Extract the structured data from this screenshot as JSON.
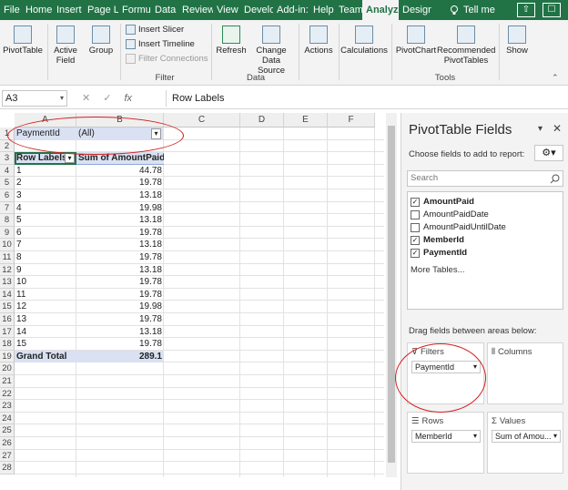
{
  "tabs": [
    "File",
    "Home",
    "Insert",
    "Page La",
    "Formul",
    "Data",
    "Review",
    "View",
    "Develo",
    "Add-in:",
    "Help",
    "Team",
    "Analyze",
    "Design"
  ],
  "tell_me": "Tell me",
  "ribbon": {
    "pivottable": "PivotTable",
    "active_field": [
      "Active",
      "Field"
    ],
    "group": "Group",
    "insert_slicer": "Insert Slicer",
    "insert_timeline": "Insert Timeline",
    "filter_connections": "Filter Connections",
    "filter_group": "Filter",
    "refresh": "Refresh",
    "change_data_source": [
      "Change Data",
      "Source"
    ],
    "data_group": "Data",
    "actions": "Actions",
    "calculations": "Calculations",
    "pivotchart": "PivotChart",
    "recommended": [
      "Recommended",
      "PivotTables"
    ],
    "tools_group": "Tools",
    "show": "Show"
  },
  "formula_bar": {
    "name_box": "A3",
    "fx": "fx",
    "value": "Row Labels"
  },
  "columns": [
    "A",
    "B",
    "C",
    "D",
    "E",
    "F"
  ],
  "rows": [
    "1",
    "2",
    "3",
    "4",
    "5",
    "6",
    "7",
    "8",
    "9",
    "10",
    "11",
    "12",
    "13",
    "14",
    "15",
    "16",
    "17",
    "18",
    "19",
    "20",
    "21",
    "22",
    "23",
    "24",
    "25",
    "26",
    "27",
    "28"
  ],
  "pivot": {
    "filter_field": "PaymentId",
    "filter_value": "(All)",
    "row_labels": "Row Labels",
    "sum_header": "Sum of AmountPaid",
    "data": [
      [
        "1",
        "44.78"
      ],
      [
        "2",
        "19.78"
      ],
      [
        "3",
        "13.18"
      ],
      [
        "4",
        "19.98"
      ],
      [
        "5",
        "13.18"
      ],
      [
        "6",
        "19.78"
      ],
      [
        "7",
        "13.18"
      ],
      [
        "8",
        "19.78"
      ],
      [
        "9",
        "13.18"
      ],
      [
        "10",
        "19.78"
      ],
      [
        "11",
        "19.78"
      ],
      [
        "12",
        "19.98"
      ],
      [
        "13",
        "19.78"
      ],
      [
        "14",
        "13.18"
      ],
      [
        "15",
        "19.78"
      ]
    ],
    "grand_total_label": "Grand Total",
    "grand_total": "289.1"
  },
  "pane": {
    "title": "PivotTable Fields",
    "choose": "Choose fields to add to report:",
    "search": "Search",
    "fields": [
      {
        "name": "AmountPaid",
        "checked": true
      },
      {
        "name": "AmountPaidDate",
        "checked": false
      },
      {
        "name": "AmountPaidUntilDate",
        "checked": false
      },
      {
        "name": "MemberId",
        "checked": true
      },
      {
        "name": "PaymentId",
        "checked": true
      }
    ],
    "more_tables": "More Tables...",
    "drag": "Drag fields between areas below:",
    "filters": "Filters",
    "columns": "Columns",
    "rows": "Rows",
    "values": "Values",
    "filters_item": "PaymentId",
    "rows_item": "MemberId",
    "values_item": "Sum of Amou..."
  },
  "colors": {
    "accent": "#217346",
    "circle": "#d42020",
    "selected": "#d9e1f2"
  }
}
